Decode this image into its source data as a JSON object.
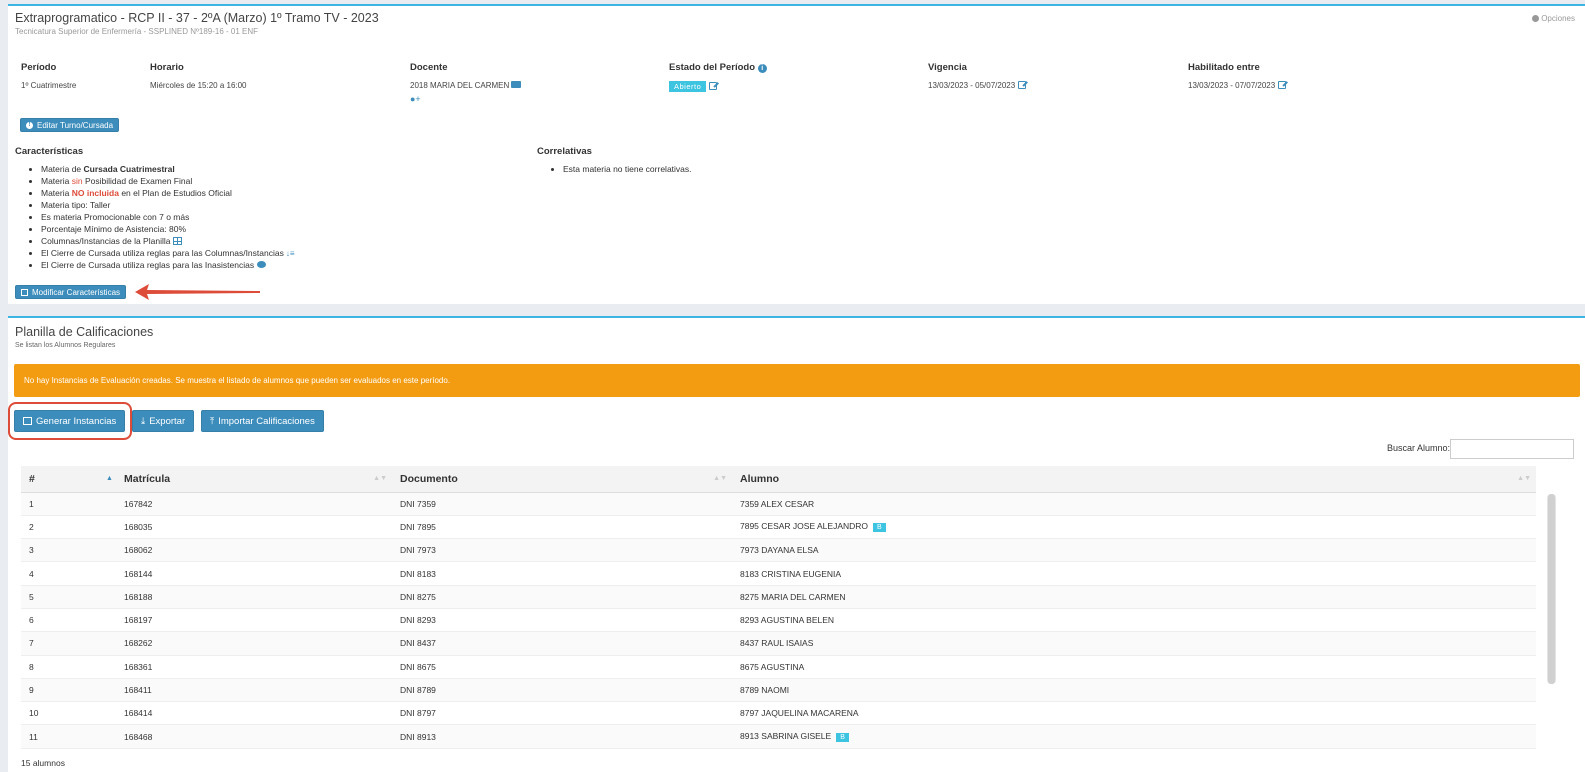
{
  "header": {
    "title": "Extraprogramatico - RCP II - 37 - 2ºA (Marzo) 1º Tramo TV - 2023",
    "subtitle": "Tecnicatura Superior de Enfermería - SSPLINED Nº189-16 - 01 ENF",
    "options_label": "Opciones"
  },
  "info": {
    "periodo": {
      "label": "Período",
      "value": "1º Cuatrimestre"
    },
    "horario": {
      "label": "Horario",
      "value": "Miércoles de 15:20 a 16:00"
    },
    "docente": {
      "label": "Docente",
      "value": "2018 MARIA DEL CARMEN"
    },
    "estado": {
      "label": "Estado del Período",
      "value": "Abierto"
    },
    "vigencia": {
      "label": "Vigencia",
      "value": "13/03/2023 - 05/07/2023"
    },
    "habilitado": {
      "label": "Habilitado entre",
      "value": "13/03/2023 - 07/07/2023"
    }
  },
  "buttons": {
    "editar_turno": "Editar Turno/Cursada",
    "modificar": "Modificar Características",
    "generar": "Generar Instancias",
    "exportar": "Exportar",
    "importar": "Importar Calificaciones"
  },
  "caracteristicas": {
    "heading": "Características",
    "items": {
      "i1_pre": "Materia de ",
      "i1_bold": "Cursada Cuatrimestral",
      "i2_pre": "Materia ",
      "i2_red": "sin",
      "i2_post": " Posibilidad de Examen Final",
      "i3_pre": "Materia ",
      "i3_red": "NO incluida",
      "i3_post": " en el Plan de Estudios Oficial",
      "i4": "Materia tipo: Taller",
      "i5": "Es materia Promocionable con 7 o más",
      "i6": "Porcentaje Mínimo de Asistencia: 80%",
      "i7": "Columnas/Instancias de la Planilla",
      "i8": "El Cierre de Cursada utiliza reglas para las Columnas/Instancias",
      "i9": "El Cierre de Cursada utiliza reglas para las Inasistencias"
    }
  },
  "correlativas": {
    "heading": "Correlativas",
    "item": "Esta materia no tiene correlativas."
  },
  "planilla": {
    "title": "Planilla de Calificaciones",
    "subtitle": "Se listan los Alumnos Regulares",
    "alert": "No hay Instancias de Evaluación creadas. Se muestra el listado de alumnos que pueden ser evaluados en este período.",
    "search_label": "Buscar Alumno:",
    "count": "15 alumnos"
  },
  "table": {
    "headers": [
      "#",
      "Matrícula",
      "Documento",
      "Alumno"
    ],
    "rows": [
      [
        "1",
        "167842",
        "DNI 7359",
        "7359 ALEX CESAR",
        ""
      ],
      [
        "2",
        "168035",
        "DNI 7895",
        "7895 CESAR JOSE ALEJANDRO",
        "B"
      ],
      [
        "3",
        "168062",
        "DNI 7973",
        "7973 DAYANA ELSA",
        ""
      ],
      [
        "4",
        "168144",
        "DNI 8183",
        "8183 CRISTINA EUGENIA",
        ""
      ],
      [
        "5",
        "168188",
        "DNI 8275",
        "8275 MARIA DEL CARMEN",
        ""
      ],
      [
        "6",
        "168197",
        "DNI 8293",
        "8293 AGUSTINA BELEN",
        ""
      ],
      [
        "7",
        "168262",
        "DNI 8437",
        "8437 RAUL ISAIAS",
        ""
      ],
      [
        "8",
        "168361",
        "DNI 8675",
        "8675 AGUSTINA",
        ""
      ],
      [
        "9",
        "168411",
        "DNI 8789",
        "8789 NAOMI",
        ""
      ],
      [
        "10",
        "168414",
        "DNI 8797",
        "8797 JAQUELINA MACARENA",
        ""
      ],
      [
        "11",
        "168468",
        "DNI 8913",
        "8913 SABRINA GISELE",
        "B"
      ]
    ]
  },
  "colors": {
    "accent": "#3c8dbc",
    "top_border": "#3cb5e5",
    "warning": "#f39c12",
    "danger": "#dd4b39",
    "info_badge": "#3cc4e0"
  }
}
